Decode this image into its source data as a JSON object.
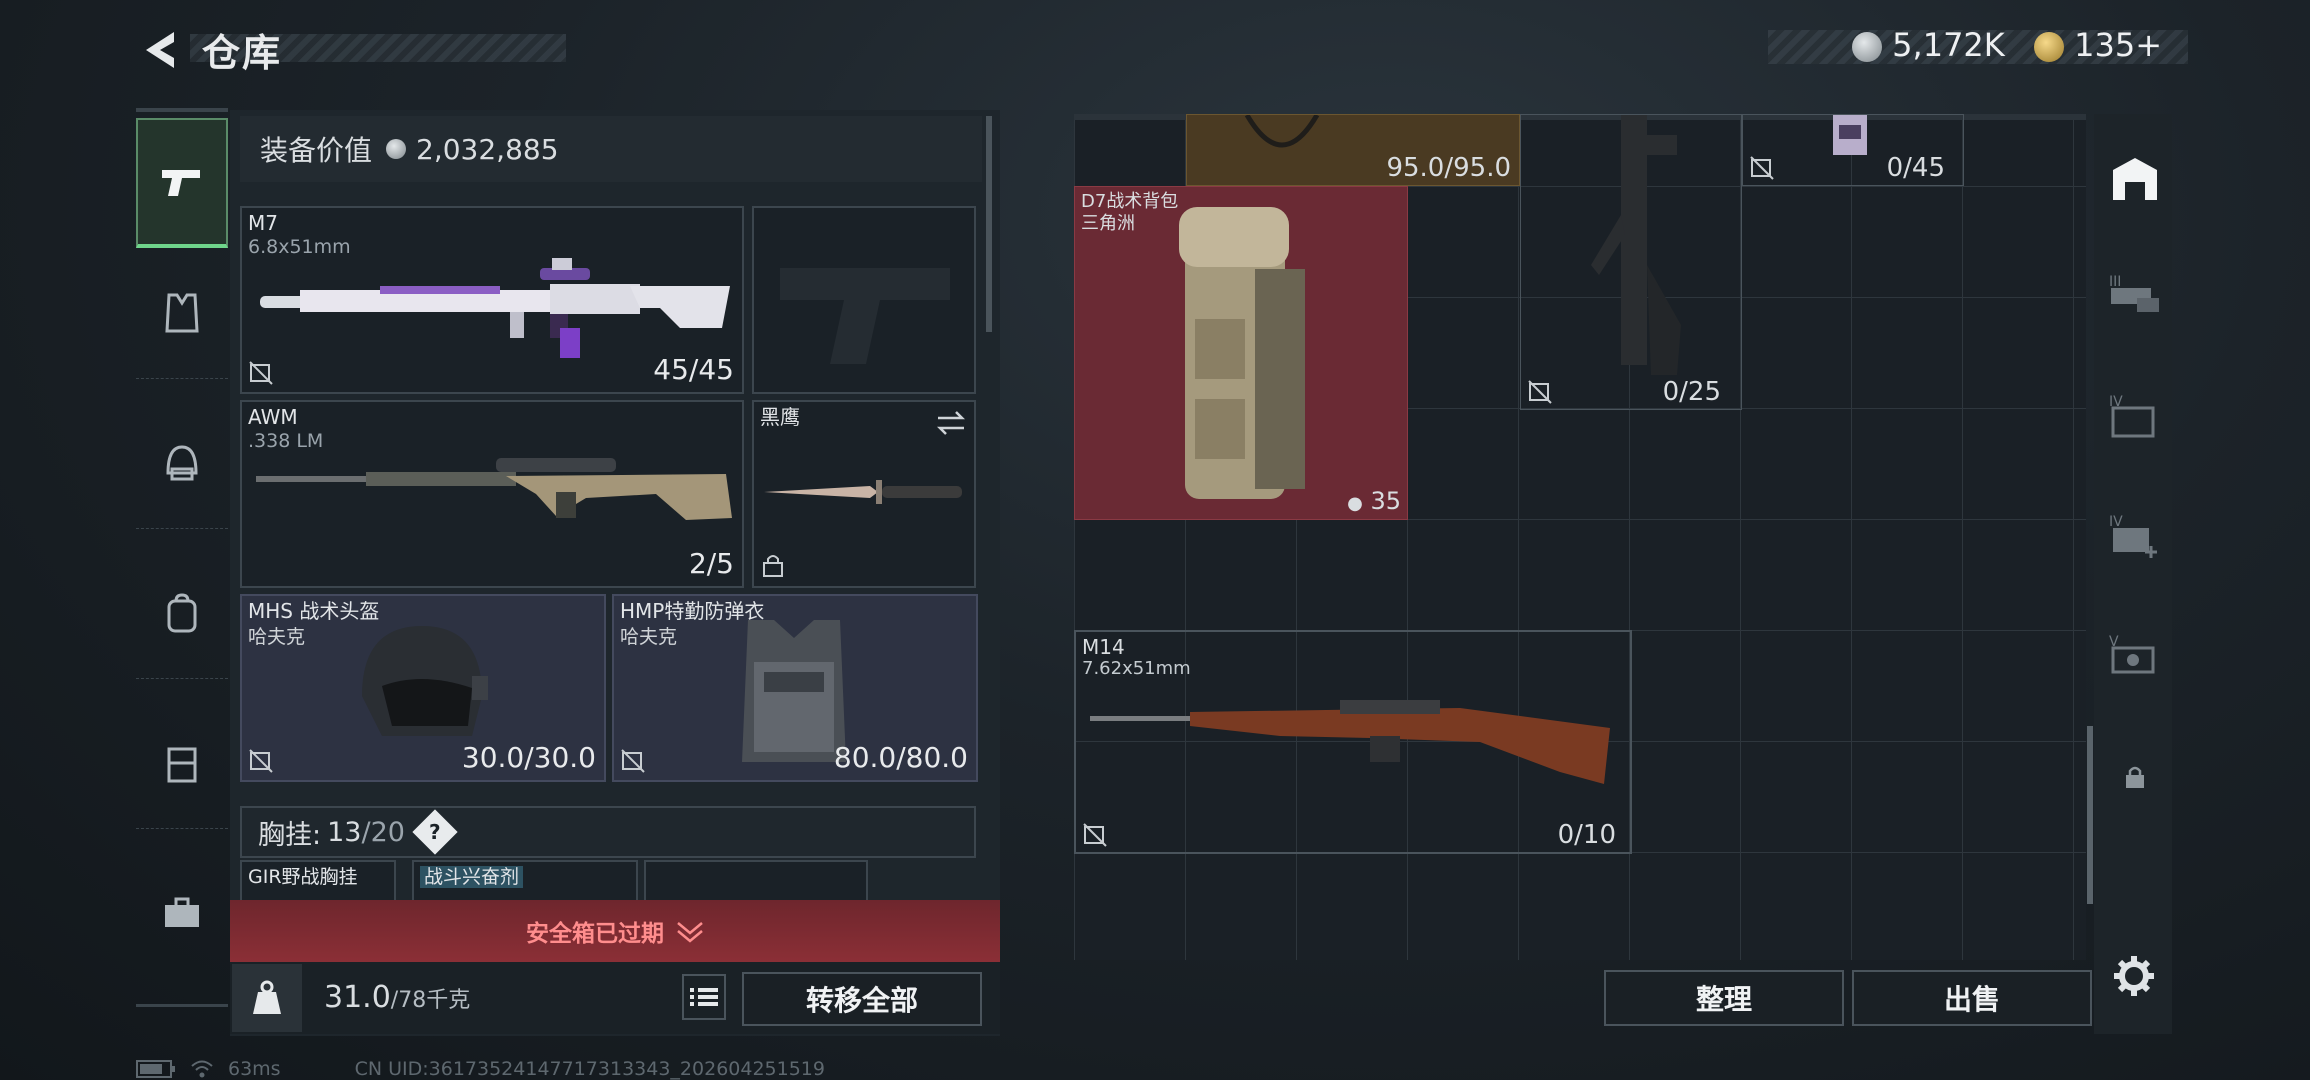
{
  "header": {
    "title": "仓库",
    "currency_a": "5,172K",
    "currency_b": "135",
    "currency_b_add": "+"
  },
  "equipment": {
    "value_label": "装备价值",
    "value": "2,032,885",
    "primary": {
      "name": "M7",
      "caliber": "6.8x51mm",
      "ammo": "45/45"
    },
    "secondary": {
      "name": "AWM",
      "caliber": ".338 LM",
      "ammo": "2/5"
    },
    "melee": {
      "name": "黑鹰"
    },
    "helmet": {
      "name": "MHS 战术头盔",
      "brand": "哈夫克",
      "durability": "30.0/30.0"
    },
    "armor": {
      "name": "HMP特勤防弹衣",
      "brand": "哈夫克",
      "durability": "80.0/80.0"
    },
    "chest_rig": {
      "label": "胸挂:",
      "value": "13",
      "max": "/20",
      "help": "?"
    },
    "rig_items": [
      "GIR野战胸挂",
      "战斗兴奋剂"
    ],
    "safebox_expired": "安全箱已过期",
    "weight": "31.0",
    "weight_max": "/78千克",
    "transfer_all": "转移全部"
  },
  "storage": {
    "top_item_a_value": "95.0/95.0",
    "top_item_b_value": "0/45",
    "backpack": {
      "name": "D7战术背包",
      "brand": "三角洲",
      "count": "35"
    },
    "smg_value": "0/25",
    "m14": {
      "name": "M14",
      "caliber": "7.62x51mm",
      "ammo": "0/10"
    },
    "sort_label": "整理",
    "sell_label": "出售"
  },
  "status": {
    "ping": "63ms",
    "uid": "CN UID:36173524147717313343_202604251519"
  },
  "colors": {
    "accent_green": "#6fd58b",
    "backpack_bg": "#6a2a34",
    "warning_red": "#7a2a30",
    "armor_bg": "#2d3242"
  }
}
